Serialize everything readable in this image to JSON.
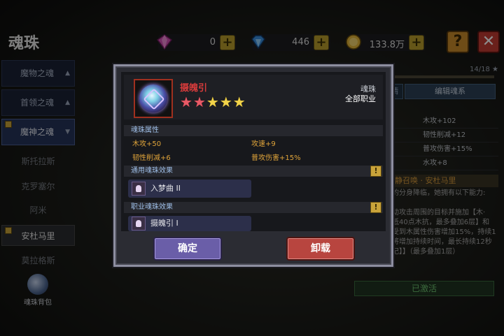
{
  "page_title": "魂珠",
  "resources": [
    {
      "name": "gem",
      "icon": "pink-gem-icon",
      "value": "0"
    },
    {
      "name": "crystal",
      "icon": "blue-diamond-icon",
      "value": "446"
    },
    {
      "name": "gold",
      "icon": "gold-coin-icon",
      "value": "133.8万"
    }
  ],
  "top_buttons": {
    "help": "?",
    "close": "✕"
  },
  "sidebar": {
    "categories": [
      {
        "label": "魔物之魂",
        "caret": "▲"
      },
      {
        "label": "首领之魂",
        "caret": "▲"
      },
      {
        "label": "魔神之魂",
        "caret": "▼"
      }
    ],
    "items": [
      "斯托拉斯",
      "克罗塞尔",
      "阿米",
      "安杜马里",
      "莫拉格斯"
    ],
    "bag_label": "魂珠背包"
  },
  "right_panel": {
    "progress_text": "14/18 ★",
    "tab_left": "情",
    "tab_right": "编辑魂系",
    "stats": [
      "木攻+102",
      "韧性削减+12",
      "普攻伤害+15%",
      "水攻+8"
    ],
    "skill_title": "静召唤 · 安杜马里",
    "desc_lines": [
      "的分身降临，她拥有以下能力:",
      "",
      "动攻击周围的目标并施加【木·",
      "低40点木抗，最多叠加6层】和",
      "受到木属性伤害增加15%，持续1",
      "将增加持续时间，最长持续12秒",
      "记】】（最多叠加1层）"
    ],
    "activated_label": "已激活"
  },
  "modal": {
    "item_name": "摄魄引",
    "stars": {
      "red": 2,
      "gold": 3,
      "total": 5
    },
    "item_type": "魂珠",
    "item_class": "全部职业",
    "attr_title": "魂珠属性",
    "attributes": [
      "木攻+50",
      "攻速+9",
      "韧性削减+6",
      "普攻伤害+15%"
    ],
    "common_title": "通用魂珠效果",
    "common_effect": "入梦曲 II",
    "class_title": "职业魂珠效果",
    "class_effect": "摄魄引 I",
    "info_icon": "!",
    "ok_label": "确定",
    "remove_label": "卸载"
  },
  "colors": {
    "item_name": "#d63b3b",
    "attribute_text": "#e0a43a",
    "section_title": "#9fbfe8",
    "ok_button": "#6a5ea8",
    "remove_button": "#b8453f",
    "activated": "#6dc36f"
  }
}
